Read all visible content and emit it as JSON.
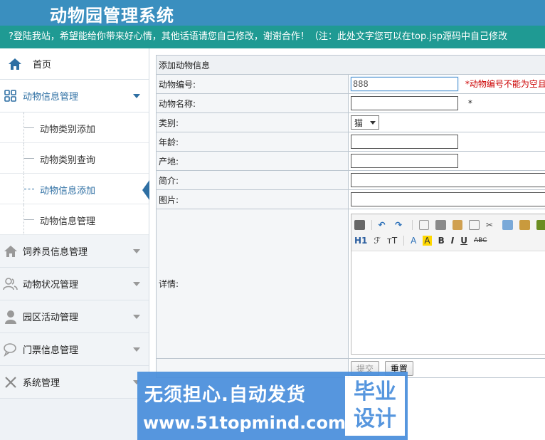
{
  "header": {
    "title": "动物园管理系统"
  },
  "marquee": {
    "text": "?登陆我站，希望能给你带来好心情，其他话语请您自己修改，谢谢合作！（注：此处文字您可以在top.jsp源码中自己修改"
  },
  "sidebar": {
    "home": {
      "label": "首页",
      "icon": "home-icon"
    },
    "groups": [
      {
        "label": "动物信息管理",
        "icon": "grid-icon",
        "open": true,
        "items": [
          {
            "label": "动物类别添加"
          },
          {
            "label": "动物类别查询"
          },
          {
            "label": "动物信息添加",
            "active": true
          },
          {
            "label": "动物信息管理"
          }
        ]
      },
      {
        "label": "饲养员信息管理",
        "icon": "home-icon"
      },
      {
        "label": "动物状况管理",
        "icon": "users-icon"
      },
      {
        "label": "园区活动管理",
        "icon": "user-icon"
      },
      {
        "label": "门票信息管理",
        "icon": "chat-icon"
      },
      {
        "label": "系统管理",
        "icon": "tools-icon"
      }
    ]
  },
  "form": {
    "title": "添加动物信息",
    "fields": {
      "number": {
        "label": "动物编号:",
        "value": "888",
        "error": "*动物编号不能为空且"
      },
      "name": {
        "label": "动物名称:",
        "value": "",
        "required": "*"
      },
      "category": {
        "label": "类别:",
        "selected": "猫"
      },
      "age": {
        "label": "年龄:",
        "value": ""
      },
      "origin": {
        "label": "产地:",
        "value": ""
      },
      "intro": {
        "label": "简介:",
        "value": ""
      },
      "image": {
        "label": "图片:",
        "value": ""
      },
      "detail": {
        "label": "详情:"
      }
    },
    "editor": {
      "heading": "H1",
      "font": "ℱ",
      "size": "тT",
      "font_color": "A",
      "bg_color": "A",
      "bold": "B",
      "italic": "I",
      "underline": "U",
      "strike": "ABC"
    },
    "submit_label": "提交",
    "reset_label": "重置"
  },
  "watermark": {
    "line1": "无须担心.自动发货",
    "line2": "www.51topmind.com",
    "badge": [
      "毕业",
      "设计"
    ]
  }
}
